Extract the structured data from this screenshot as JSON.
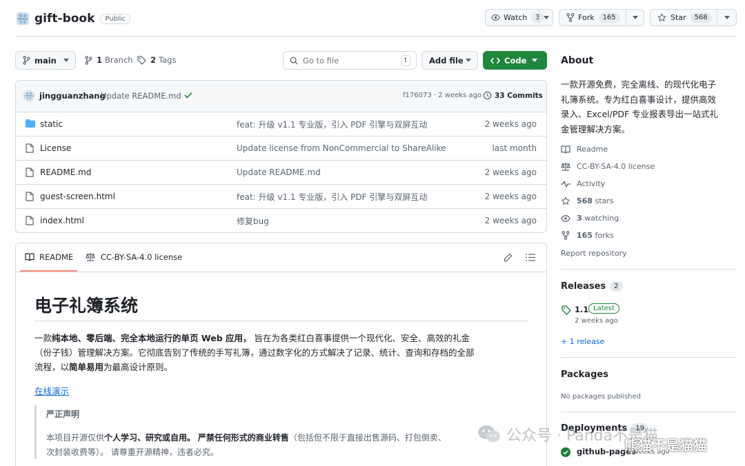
{
  "repo": {
    "name": "gift-book",
    "visibility": "Public"
  },
  "header_actions": {
    "watch_label": "Watch",
    "watch_count": "3",
    "fork_label": "Fork",
    "fork_count": "165",
    "star_label": "Star",
    "star_count": "568"
  },
  "toolbar": {
    "branch": "main",
    "branches_count": "1",
    "branches_label": "Branch",
    "tags_count": "2",
    "tags_label": "Tags",
    "search_placeholder": "Go to file",
    "search_shortcut": "t",
    "add_file_label": "Add file",
    "code_label": "Code"
  },
  "commit": {
    "author": "jingguanzhang",
    "message": "Update README.md",
    "hash_time": "f176073 · 2 weeks ago",
    "commits_count": "33 Commits"
  },
  "files": [
    {
      "icon": "folder-icon",
      "name": "static",
      "message": "feat: 升级 v1.1 专业版，引入 PDF 引擎与双屏互动",
      "date": "2 weeks ago"
    },
    {
      "icon": "file-icon",
      "name": "License",
      "message": "Update license from NonCommercial to ShareAlike",
      "date": "last month"
    },
    {
      "icon": "file-icon",
      "name": "README.md",
      "message": "Update README.md",
      "date": "2 weeks ago"
    },
    {
      "icon": "file-icon",
      "name": "guest-screen.html",
      "message": "feat: 升级 v1.1 专业版，引入 PDF 引擎与双屏互动",
      "date": "2 weeks ago"
    },
    {
      "icon": "file-icon",
      "name": "index.html",
      "message": "修复bug",
      "date": "2 weeks ago"
    }
  ],
  "readme_tabs": {
    "readme": "README",
    "license": "CC-BY-SA-4.0 license"
  },
  "readme": {
    "title": "电子礼簿系统",
    "p1_a": "一款",
    "p1_b": "纯本地、零后端、完全本地运行的单页 Web 应用，",
    "p1_c": " 旨在为各类红白喜事提供一个现代化、安全、高效的礼金",
    "p1_line2": "（份子钱）管理解决方案。它彻底告别了传统的手写礼簿，通过数字化的方式解决了记录、统计、查询和存档的全部",
    "p1_line3_a": "流程，以",
    "p1_line3_b": "简单易用",
    "p1_line3_c": "为最高设计原则。",
    "demo_link": "在线演示",
    "notice_title": "严正声明",
    "notice_a": "本项目开源仅供",
    "notice_b": "个人学习、研究或自用。",
    "notice_c": " ",
    "notice_d": "严禁任何形式的商业转售",
    "notice_e": "（包括但不限于直接出售源码、打包倒卖、",
    "notice_line2": "次封装收费等）。 请尊重开源精神，违者必究。"
  },
  "about": {
    "heading": "About",
    "description_lines": [
      "一款开源免费，完全离线、的现代化电子",
      "礼簿系统。专为红白喜事设计，提供高效",
      "录入、Excel/PDF 专业报表导出一站式礼",
      "金管理解决方案。"
    ],
    "links": [
      {
        "icon": "book-icon",
        "label": "Readme",
        "bold": ""
      },
      {
        "icon": "law-icon",
        "label": "CC-BY-SA-4.0 license",
        "bold": ""
      },
      {
        "icon": "pulse-icon",
        "label": "Activity",
        "bold": ""
      },
      {
        "icon": "star-icon",
        "label": " stars",
        "bold": "568"
      },
      {
        "icon": "eye-icon",
        "label": " watching",
        "bold": "3"
      },
      {
        "icon": "fork-icon",
        "label": " forks",
        "bold": "165"
      }
    ],
    "report": "Report repository"
  },
  "releases": {
    "heading": "Releases",
    "count": "2",
    "tag": "1.1",
    "badge": "Latest",
    "date": "2 weeks ago",
    "more": "+ 1 release"
  },
  "packages": {
    "heading": "Packages",
    "empty": "No packages published"
  },
  "deployments": {
    "heading": "Deployments",
    "count": "19",
    "item": "github-pages",
    "item_time": "2 weeks ago"
  },
  "watermark": {
    "text": "公众号 · Panda不是猫",
    "overlay": "熊猫不是猫猫"
  },
  "colors": {
    "accent_green": "#1f883d",
    "link_blue": "#0969da",
    "muted": "#59636e",
    "border": "#d1d9e0"
  }
}
